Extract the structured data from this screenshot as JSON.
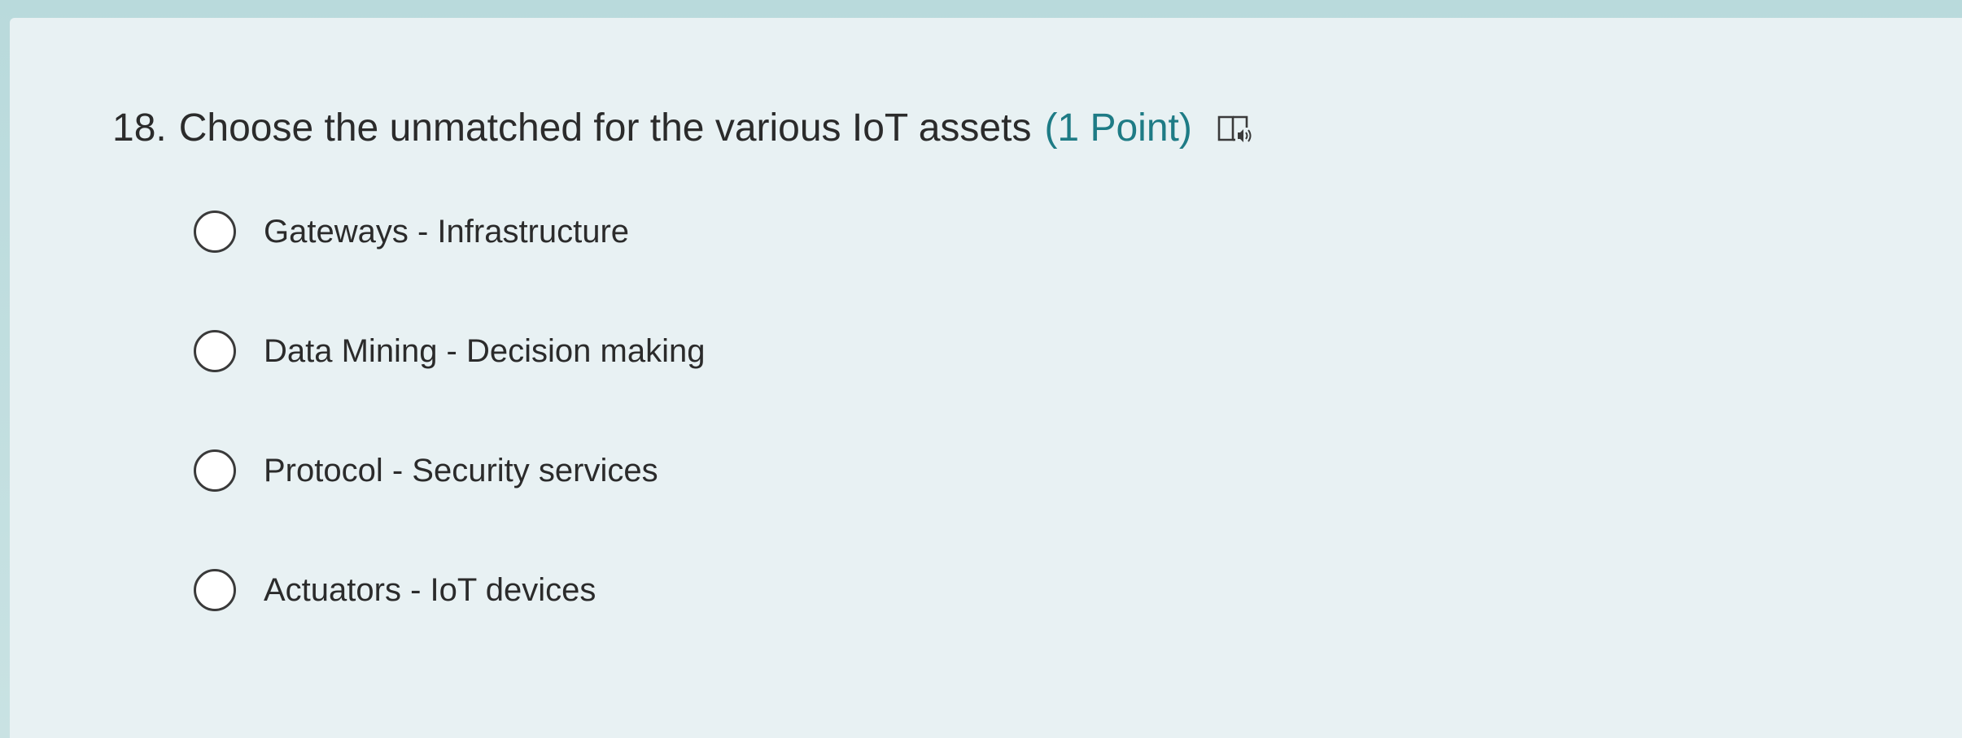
{
  "question": {
    "number": "18.",
    "text": "Choose the unmatched for the various IoT assets",
    "points": "(1 Point)",
    "reader_icon": "immersive-reader-icon"
  },
  "options": [
    "Gateways - Infrastructure",
    "Data Mining - Decision making",
    "Protocol - Security services",
    "Actuators - IoT devices"
  ],
  "colors": {
    "background": "#c3dfe0",
    "card": "#e8f1f3",
    "text": "#2b2b2b",
    "points_accent": "#1e7b85"
  }
}
